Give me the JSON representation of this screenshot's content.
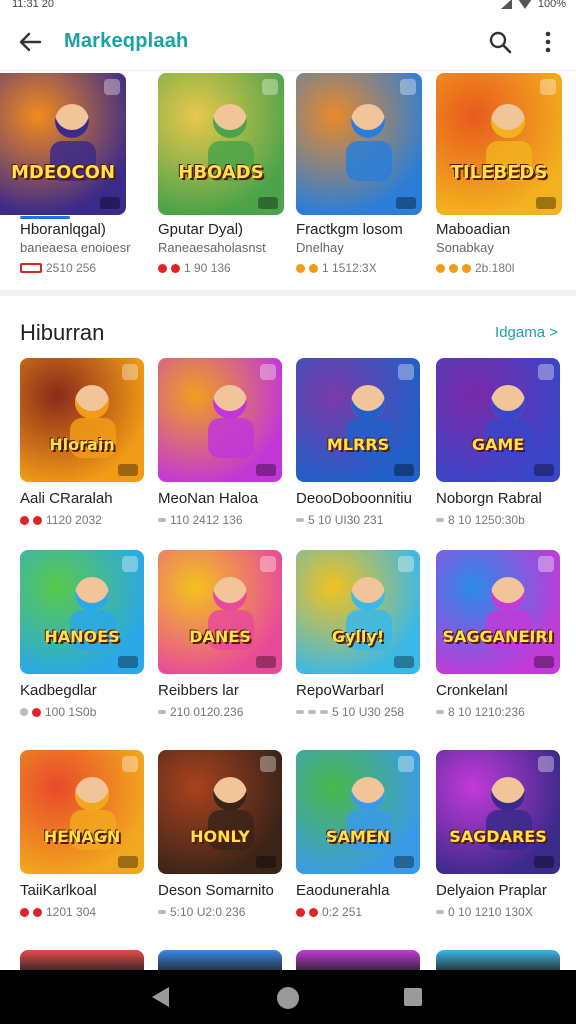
{
  "status_bar": {
    "time": "11:31 20",
    "battery": "100%"
  },
  "app_bar": {
    "title": "Markeqplaah"
  },
  "carousel": [
    {
      "title": "Hboranlqgal)",
      "subtitle": "baneaesa enoioesr",
      "meta": "2510 256",
      "rating_type": "tag",
      "art_text": "MDEOCON",
      "c1": "#3b2a8a",
      "c2": "#f28a1e"
    },
    {
      "title": "Gputar Dyal)",
      "subtitle": "Raneaesaholasnst",
      "meta": "1 90 136",
      "rating_type": "red2",
      "art_text": "HBOADS",
      "c1": "#4ca34a",
      "c2": "#e8c84a"
    },
    {
      "title": "Fractkgm losom",
      "subtitle": "Dnelhay",
      "meta": "1 1512:3X",
      "rating_type": "orange2",
      "art_text": "",
      "c1": "#2a7ed8",
      "c2": "#e88a2a"
    },
    {
      "title": "Maboadian",
      "subtitle": "Sonabkay",
      "meta": "2b.180l",
      "rating_type": "orange3",
      "art_text": "TILEBEDS",
      "c1": "#f2b11e",
      "c2": "#e85a1e"
    }
  ],
  "section": {
    "title": "Hiburran",
    "link": "Idgama >"
  },
  "grid": [
    {
      "title": "Aali CRaralah",
      "meta": "1120 2032",
      "rating_type": "red2",
      "art_text": "Hlorain",
      "c1": "#f29b16",
      "c2": "#8a2a1a"
    },
    {
      "title": "MeoNan Haloa",
      "meta": "110 2412 136",
      "rating_type": "bar",
      "art_text": "",
      "c1": "#c236d8",
      "c2": "#f0a01e"
    },
    {
      "title": "DeooDoboonnitiu",
      "meta": "5 10 UI30 231",
      "rating_type": "bar",
      "art_text": "MLRRS",
      "c1": "#2060c8",
      "c2": "#7a3aa8"
    },
    {
      "title": "Noborgn Rabral",
      "meta": "8 10 1250:30b",
      "rating_type": "bar",
      "art_text": "GAME",
      "c1": "#3a46c8",
      "c2": "#7a2aa8"
    },
    {
      "title": "Kadbegdlar",
      "meta": "100 1S0b",
      "rating_type": "mixed",
      "art_text": "HANOES",
      "c1": "#2aa8e8",
      "c2": "#5ac84a"
    },
    {
      "title": "Reibbers lar",
      "meta": "210 0120.236",
      "rating_type": "bar",
      "art_text": "DANES",
      "c1": "#e84a9a",
      "c2": "#f2c21e"
    },
    {
      "title": "RepoWarbarl",
      "meta": "5 10 U30 258",
      "rating_type": "bar2",
      "art_text": "Gylly!",
      "c1": "#3ab8e8",
      "c2": "#f2c21e"
    },
    {
      "title": "Cronkelanl",
      "meta": "8 10 1210:236",
      "rating_type": "bar",
      "art_text": "SAGGANEIRI",
      "c1": "#c23ad8",
      "c2": "#2a8ae8"
    },
    {
      "title": "TaiiKarlkoal",
      "meta": "1201 304",
      "rating_type": "red2",
      "art_text": "HENAGN",
      "c1": "#f2a81e",
      "c2": "#e84a2a"
    },
    {
      "title": "Deson Somarnito",
      "meta": "5:10 U2:0 236",
      "rating_type": "bar",
      "art_text": "HONLY",
      "c1": "#3a2418",
      "c2": "#a8421e"
    },
    {
      "title": "Eaodunerahla",
      "meta": "0:2 251",
      "rating_type": "red2",
      "art_text": "SAMEN",
      "c1": "#3a9ae8",
      "c2": "#4ab84a"
    },
    {
      "title": "Delyaion Praplar",
      "meta": "0 10 1210 130X",
      "rating_type": "bar",
      "art_text": "SAGDARES",
      "c1": "#3a2a8a",
      "c2": "#c23ad8"
    }
  ],
  "partial_row": [
    {
      "c1": "#e84a4a"
    },
    {
      "c1": "#3a8ae8"
    },
    {
      "c1": "#c23ad8"
    },
    {
      "c1": "#3ab8e8"
    }
  ]
}
